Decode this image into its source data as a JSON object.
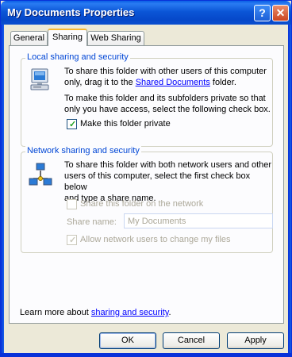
{
  "window": {
    "title": "My Documents Properties",
    "help_glyph": "?",
    "close_glyph": "✕"
  },
  "tabs": [
    {
      "label": "General",
      "selected": false
    },
    {
      "label": "Sharing",
      "selected": true
    },
    {
      "label": "Web Sharing",
      "selected": false
    }
  ],
  "local": {
    "title": "Local sharing and security",
    "icon": "computer-icon",
    "text1_line1": "To share this folder with other users of this computer",
    "text1_line2_prefix": "only, drag it to the ",
    "text1_link": "Shared Documents",
    "text1_line2_suffix": " folder.",
    "text2_line1": "To make this folder and its subfolders private so that",
    "text2_line2": "only you have access, select the following check box.",
    "private_label": "Make this folder private",
    "private_checked": true
  },
  "network": {
    "title": "Network sharing and security",
    "icon": "network-computers-icon",
    "text_line1": "To share this folder with both network users and other",
    "text_line2": "users of this computer, select the first check box below",
    "text_line3": "and type a share name.",
    "share_label": "Share this folder on the network",
    "share_checked": false,
    "share_name_label": "Share name:",
    "share_name_value": "My Documents",
    "allow_label": "Allow network users to change my files",
    "allow_checked": true
  },
  "footer": {
    "learn_prefix": "Learn more about ",
    "learn_link": "sharing and security",
    "learn_suffix": "."
  },
  "buttons": {
    "ok": "OK",
    "cancel": "Cancel",
    "apply": "Apply"
  }
}
